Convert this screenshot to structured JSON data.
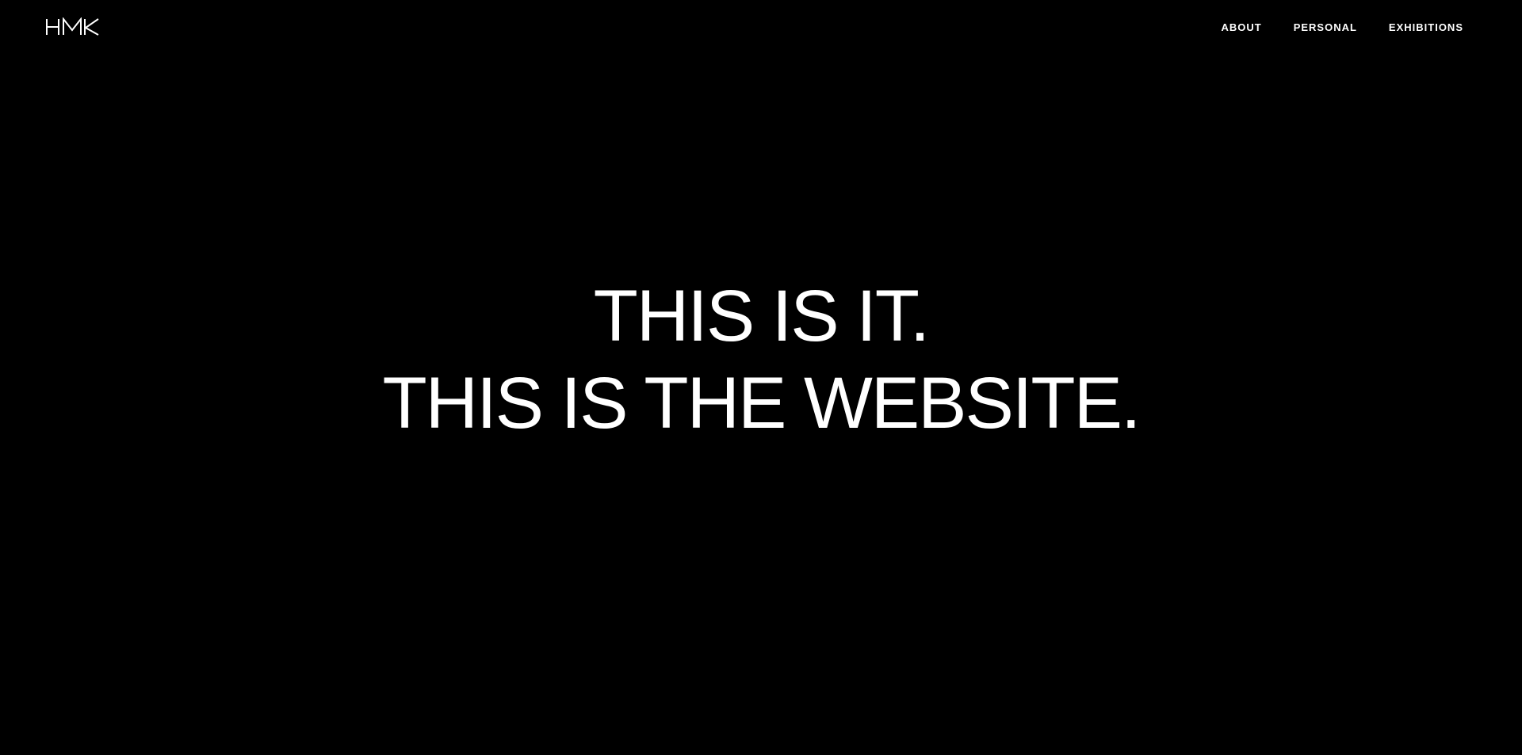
{
  "header": {
    "logo_text": "HMK",
    "logo_icon": "hmk-logo-icon"
  },
  "nav": {
    "items": [
      {
        "label": "ABOUT"
      },
      {
        "label": "PERSONAL"
      },
      {
        "label": "EXHIBITIONS"
      }
    ]
  },
  "hero": {
    "line1": "THIS IS IT.",
    "line2": "THIS IS THE WEBSITE."
  },
  "colors": {
    "background": "#000000",
    "text": "#ffffff"
  }
}
